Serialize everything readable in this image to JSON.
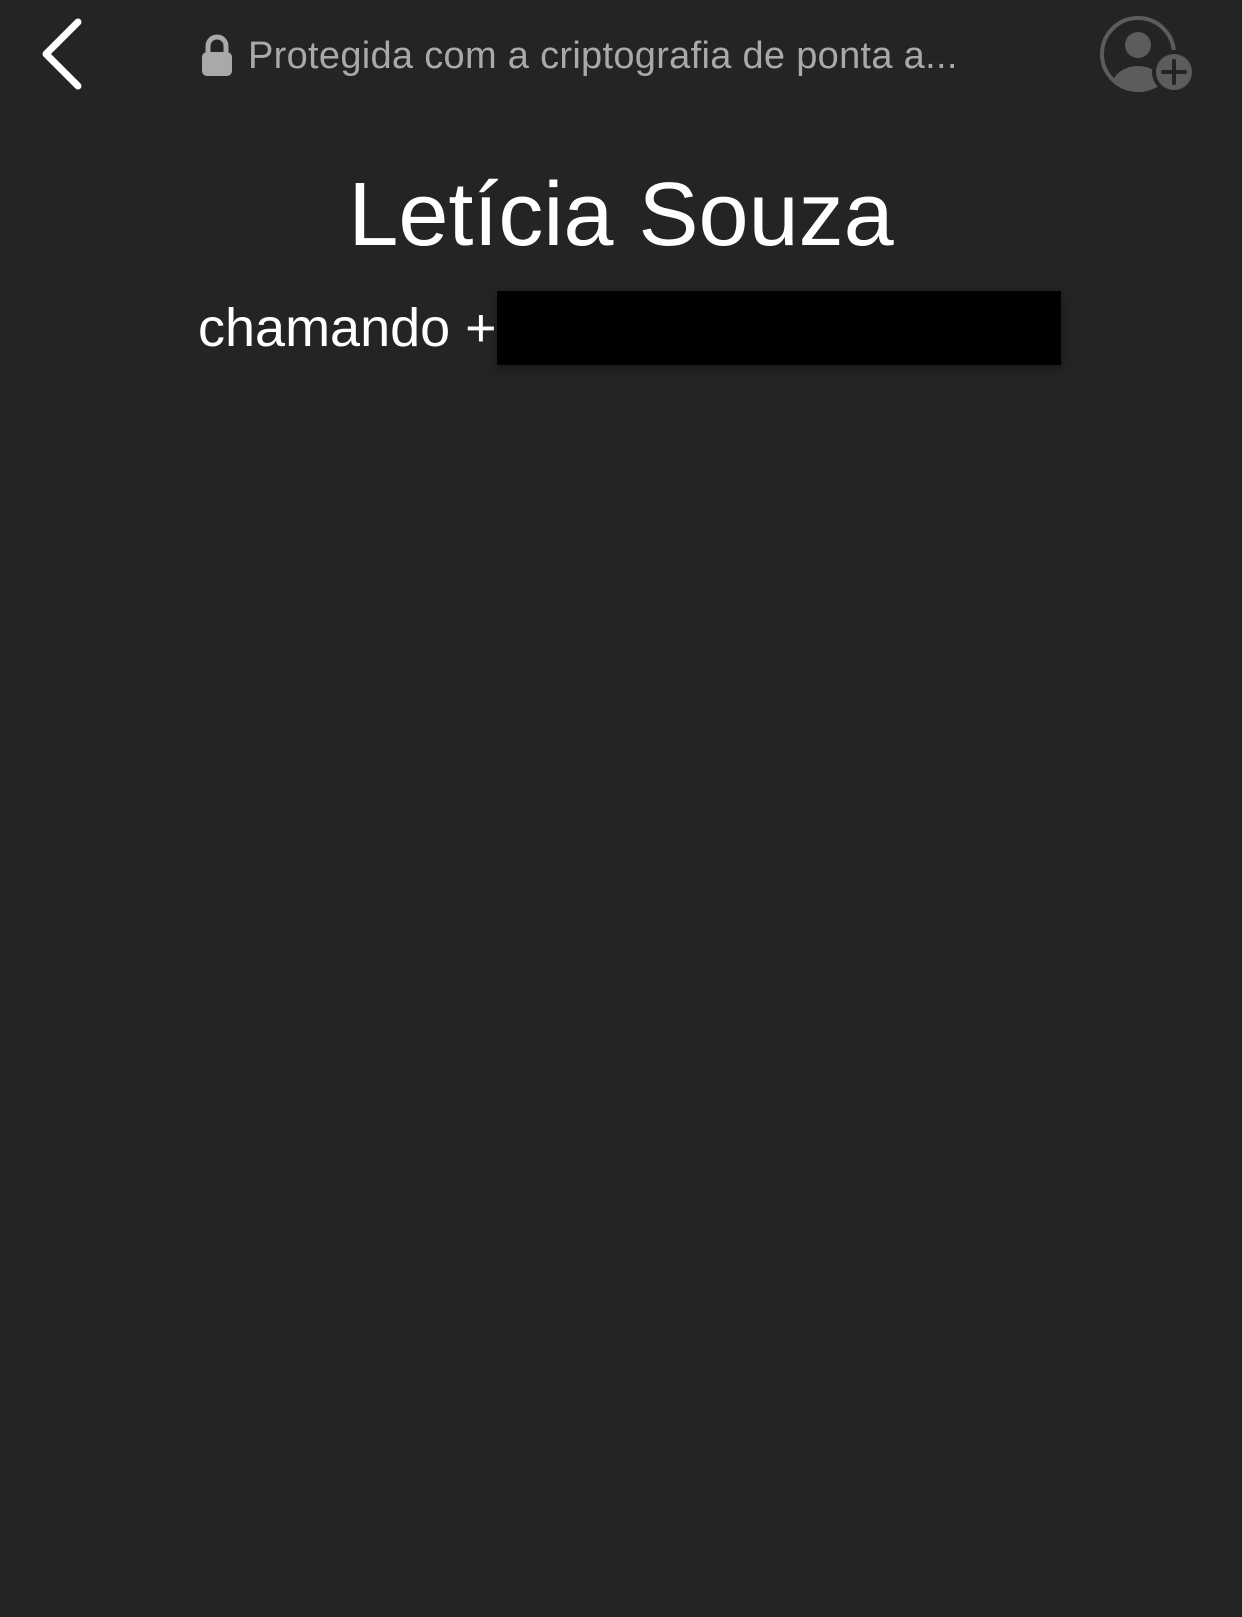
{
  "header": {
    "back_icon": "chevron-left-icon",
    "lock_icon": "lock-icon",
    "encryption_notice": "Protegida com a criptografia de ponta a...",
    "add_contact_icon": "add-person-icon"
  },
  "call": {
    "caller_name": "Letícia Souza",
    "status_prefix": "chamando +"
  },
  "colors": {
    "background": "#242424",
    "primary_text": "#ffffff",
    "secondary_text": "#a9a9a9",
    "redaction": "#000000"
  }
}
